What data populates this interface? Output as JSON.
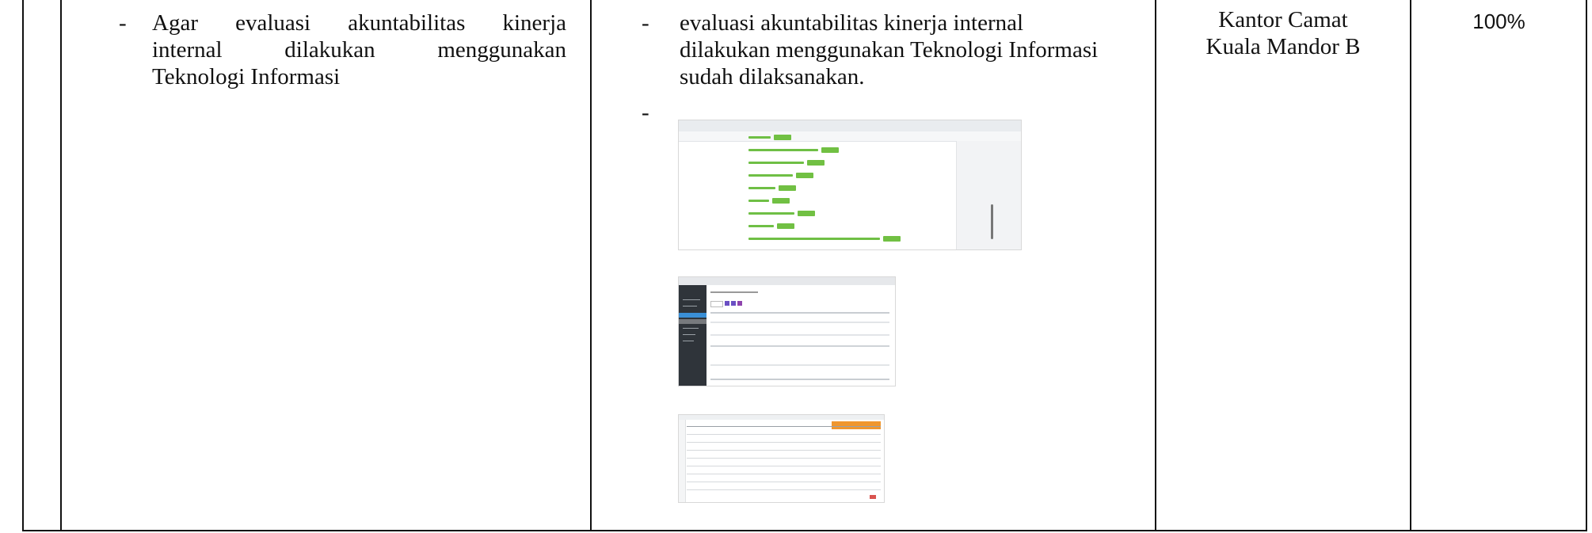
{
  "row": {
    "col2": {
      "dash": "-",
      "text_lines": [
        "Agar evaluasi akuntabilitas kinerja",
        "internal dilakukan menggunakan",
        "Teknologi Informasi"
      ]
    },
    "col3": {
      "dash1": "-",
      "text_lines": [
        "evaluasi akuntabilitas kinerja internal",
        "dilakukan menggunakan Teknologi Informasi",
        "sudah dilaksanakan."
      ],
      "dash2": "-",
      "evidence_screenshots": [
        "screenshot-document-list",
        "screenshot-dashboard-table",
        "screenshot-spreadsheet-table"
      ]
    },
    "col4": {
      "lines": [
        "Kantor Camat",
        "Kuala Mandor B"
      ]
    },
    "col5": {
      "value": "100%"
    }
  }
}
